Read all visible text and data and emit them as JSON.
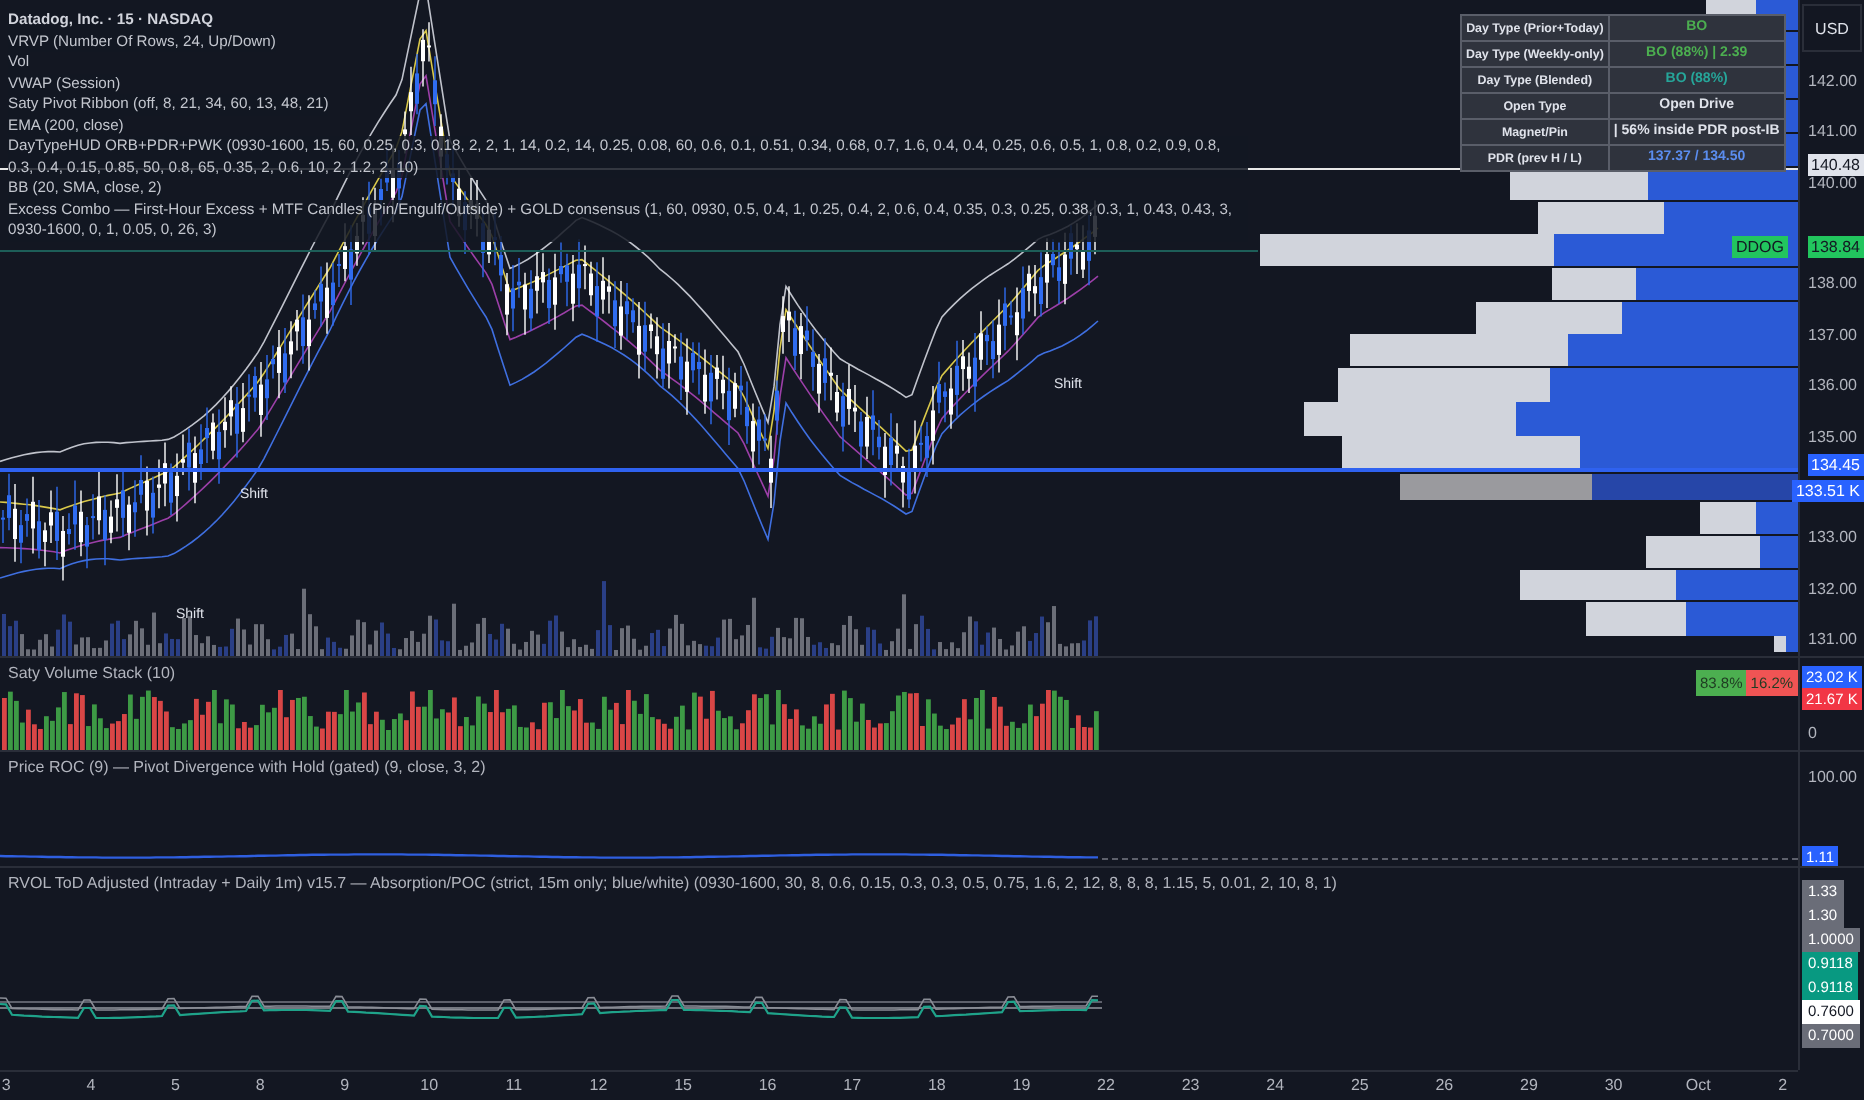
{
  "legend": {
    "symbol": "Datadog, Inc. · 15 · NASDAQ",
    "indicators": [
      "VRVP (Number Of Rows, 24, Up/Down)",
      "Vol",
      "VWAP (Session)",
      "Saty Pivot Ribbon (off, 8, 21, 34, 60, 13, 48, 21)",
      "EMA (200, close)",
      "DayTypeHUD ORB+PDR+PWK (0930-1600, 15, 60, 0.25, 0.3, 0.18, 2, 2, 1, 14, 0.2, 14, 0.25, 0.08, 60, 0.6, 0.1, 0.51, 0.34, 0.68, 0.7, 1.6, 0.4, 0.4, 0.25, 0.6, 0.5, 1, 0.8, 0.2, 0.9, 0.8, 0.3, 0.4, 0.15, 0.85, 50, 0.8, 65, 0.35, 2, 0.6, 10, 2, 1.2, 2, 10)",
      "BB (20, SMA, close, 2)",
      "Excess Combo — First-Hour Excess + MTF Candles (Pin/Engulf/Outside) + GOLD consensus (1, 60, 0930, 0.5, 0.4, 1, 0.25, 0.4, 2, 0.6, 0.4, 0.35, 0.3, 0.25, 0.38, 0.3, 1, 0.43, 0.43, 3, 0930-1600, 0, 1, 0.05, 0, 26, 3)"
    ]
  },
  "chart_labels": [
    "Shift",
    "Shift",
    "Shift"
  ],
  "day_type_table": {
    "rows": [
      {
        "label": "Day Type (Prior+Today)",
        "value": "BO",
        "color": "#4caf50"
      },
      {
        "label": "Day Type (Weekly-only)",
        "value": "BO (88%) | 2.39",
        "color": "#4caf50"
      },
      {
        "label": "Day Type (Blended)",
        "value": "BO (88%)",
        "color": "#26a69a"
      },
      {
        "label": "Open Type",
        "value": "Open Drive",
        "color": "#e0e3eb"
      },
      {
        "label": "Magnet/Pin",
        "value": "| 56% inside PDR post-IB",
        "color": "#e0e3eb"
      },
      {
        "label": "PDR (prev H / L)",
        "value": "137.37 / 134.50",
        "color": "#5b8def"
      }
    ]
  },
  "price_axis": {
    "currency": "USD",
    "ticks": [
      "142.00",
      "141.00",
      "140.00",
      "138.00",
      "137.00",
      "136.00",
      "135.00",
      "133.00",
      "132.00",
      "131.00"
    ],
    "badges": [
      {
        "text": "140.48",
        "kind": "level"
      },
      {
        "text": "138.84",
        "symbol": "DDOG",
        "kind": "last"
      },
      {
        "text": "134.45",
        "kind": "line"
      },
      {
        "text": "133.51 K",
        "kind": "volume"
      }
    ]
  },
  "volume_stack": {
    "title": "Saty Volume Stack (10)",
    "shares": [
      {
        "text": "83.8%",
        "color": "#4caf50"
      },
      {
        "text": "16.2%",
        "color": "#f05454"
      }
    ],
    "badges": [
      {
        "text": "23.02 K",
        "color": "#2962ff"
      },
      {
        "text": "21.67 K",
        "color": "#f23645"
      }
    ],
    "tick": "0"
  },
  "roc": {
    "title": "Price ROC (9) — Pivot Divergence with Hold (gated) (9, close, 3, 2)",
    "tick": "100.00",
    "badge": "1.11"
  },
  "rvol": {
    "title": "RVOL ToD Adjusted (Intraday + Daily 1m) v15.7 — Absorption/POC (strict, 15m only; blue/white) (0930-1600, 30, 8, 0.6, 0.15, 0.3, 0.3, 0.5, 0.75, 1.6, 2, 12, 8, 8, 8, 1.15, 5, 0.01, 2, 10, 8, 1)",
    "badges": [
      {
        "text": "1.33",
        "kind": "grey"
      },
      {
        "text": "1.30",
        "kind": "grey"
      },
      {
        "text": "1.0000",
        "kind": "grey"
      },
      {
        "text": "0.9118",
        "kind": "green"
      },
      {
        "text": "0.9118",
        "kind": "green"
      },
      {
        "text": "0.7600",
        "kind": "white"
      },
      {
        "text": "0.7000",
        "kind": "grey"
      }
    ]
  },
  "time_axis": [
    "3",
    "4",
    "5",
    "8",
    "9",
    "10",
    "11",
    "12",
    "15",
    "16",
    "17",
    "18",
    "19",
    "22",
    "23",
    "24",
    "25",
    "26",
    "29",
    "30",
    "Oct",
    "2"
  ]
}
